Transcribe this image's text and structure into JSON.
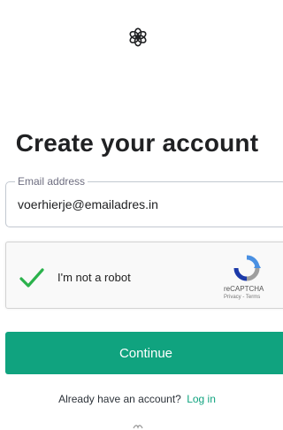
{
  "brand": {
    "logo": "openai-logo-icon"
  },
  "title": "Create your account",
  "email": {
    "label": "Email address",
    "value": "voerhierje@emailadres.in"
  },
  "captcha": {
    "label": "I'm not a robot",
    "checked": true,
    "brand_text": "reCAPTCHA",
    "links_text": "Privacy - Terms",
    "check_color": "#2bb24c"
  },
  "continue_button": {
    "label": "Continue",
    "color": "#10a37f"
  },
  "footer": {
    "prompt": "Already have an account?",
    "login_label": "Log in"
  }
}
